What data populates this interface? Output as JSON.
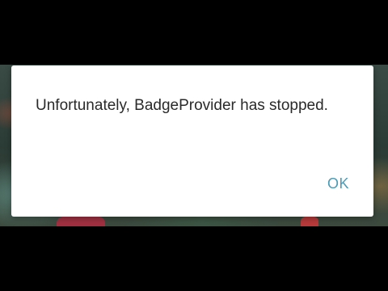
{
  "dialog": {
    "message": "Unfortunately, BadgeProvider has stopped.",
    "ok_label": "OK"
  },
  "colors": {
    "accent": "#4a9bb5",
    "dialog_background": "#ffffff",
    "message_text": "#2a2a2a"
  }
}
